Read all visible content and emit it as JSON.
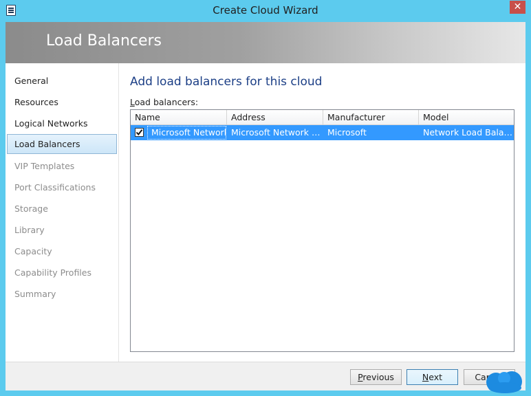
{
  "window": {
    "title": "Create Cloud Wizard",
    "close_glyph": "✕"
  },
  "banner": {
    "title": "Load Balancers"
  },
  "sidebar": {
    "items": [
      {
        "label": "General",
        "state": "enabled"
      },
      {
        "label": "Resources",
        "state": "enabled"
      },
      {
        "label": "Logical Networks",
        "state": "enabled"
      },
      {
        "label": "Load Balancers",
        "state": "active"
      },
      {
        "label": "VIP Templates",
        "state": "disabled"
      },
      {
        "label": "Port Classifications",
        "state": "disabled"
      },
      {
        "label": "Storage",
        "state": "disabled"
      },
      {
        "label": "Library",
        "state": "disabled"
      },
      {
        "label": "Capacity",
        "state": "disabled"
      },
      {
        "label": "Capability Profiles",
        "state": "disabled"
      },
      {
        "label": "Summary",
        "state": "disabled"
      }
    ]
  },
  "main": {
    "heading": "Add load balancers for this cloud",
    "list_label_accel": "L",
    "list_label_rest": "oad balancers:",
    "columns": [
      "Name",
      "Address",
      "Manufacturer",
      "Model"
    ],
    "rows": [
      {
        "checked": true,
        "name": "Microsoft Network Load Balancing",
        "address": "Microsoft Network Load Balancing",
        "manufacturer": "Microsoft",
        "model": "Network Load Balancing"
      }
    ]
  },
  "footer": {
    "previous_accel": "P",
    "previous_rest": "revious",
    "next_accel": "N",
    "next_rest": "ext",
    "cancel_label": "Cancel"
  },
  "colors": {
    "title_bar": "#5ccbee",
    "heading": "#1c3f86",
    "selection": "#3399ff",
    "close_button": "#c7504a"
  },
  "icons": [
    "app-icon",
    "close-icon",
    "checkmark-icon"
  ]
}
